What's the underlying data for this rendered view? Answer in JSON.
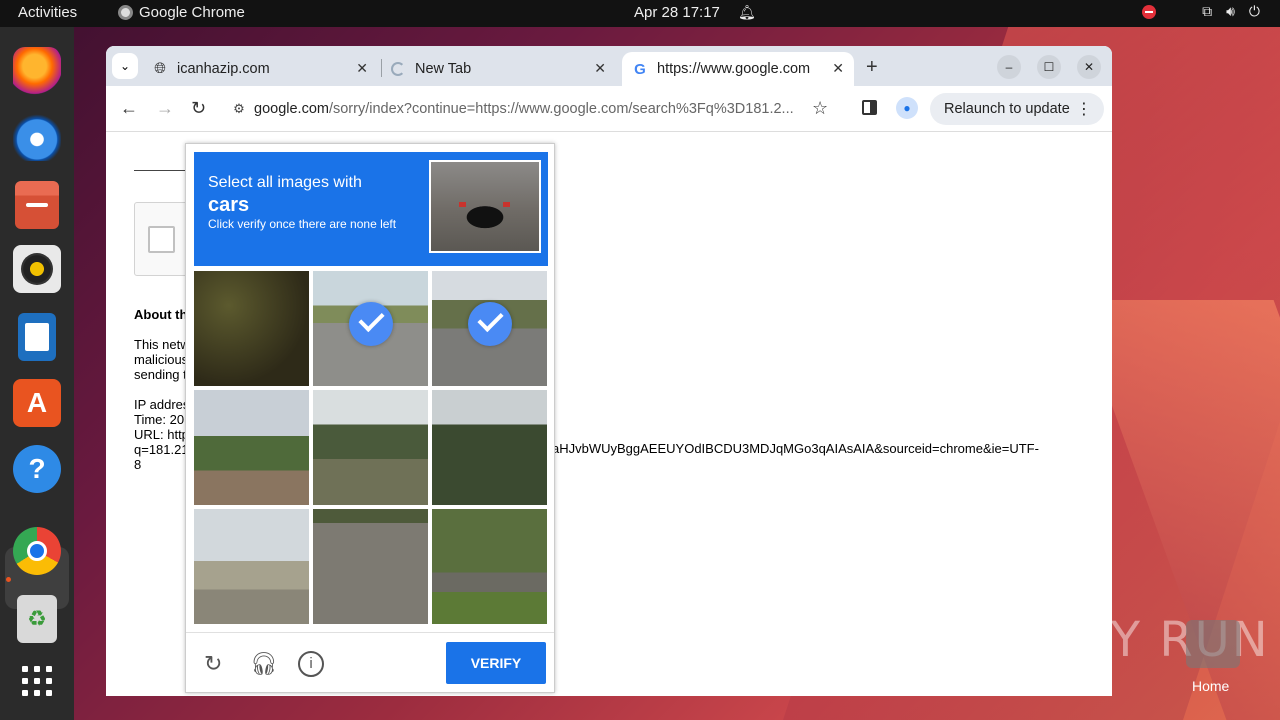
{
  "topbar": {
    "activities": "Activities",
    "app_name": "Google Chrome",
    "clock": "Apr 28  17:17"
  },
  "dock": {
    "items": [
      "firefox-icon",
      "thunderbird-icon",
      "files-icon",
      "rhythmbox-icon",
      "writer-icon",
      "software-icon",
      "help-icon",
      "chrome-icon",
      "trash-icon",
      "apps-grid-icon"
    ]
  },
  "browser": {
    "tabs": [
      {
        "title": "icanhazip.com"
      },
      {
        "title": "New Tab"
      },
      {
        "title": "https://www.google.com"
      }
    ],
    "url_host": "google.com",
    "url_path": "/sorry/index?continue=https://www.google.com/search%3Fq%3D181.2...",
    "relaunch_label": "Relaunch to update"
  },
  "page": {
    "about": "About th",
    "para1": [
      "This netw",
      "malicious",
      "sending t"
    ],
    "ip_label": "IP addres",
    "time_label": "Time: 20",
    "url_label": "URL: http",
    "q_label": "q=181.21",
    "q_tail": "aHJvbWUyBggAEEUYOdIBCDU3MDJqMGo3qAIAsAIA&sourceid=chrome&ie=UTF-",
    "eight": "8"
  },
  "captcha": {
    "line1": "Select all images with",
    "target": "cars",
    "line3": "Click verify once there are none left",
    "verify_label": "VERIFY",
    "tiles_selected": [
      false,
      true,
      true,
      false,
      false,
      false,
      false,
      false,
      false
    ]
  },
  "watermark": {
    "text": "ANY RUN",
    "home_label": "Home"
  }
}
